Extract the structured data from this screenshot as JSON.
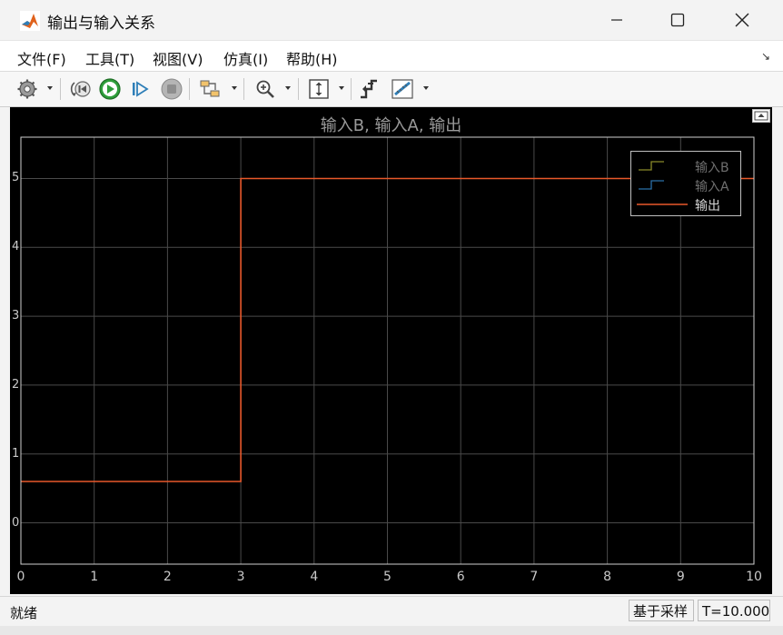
{
  "window": {
    "title": "输出与输入关系"
  },
  "menubar": {
    "items": [
      "文件(F)",
      "工具(T)",
      "视图(V)",
      "仿真(I)",
      "帮助(H)"
    ]
  },
  "toolbar": {
    "icons": [
      "settings-icon",
      "step-back-icon",
      "run-icon",
      "step-forward-icon",
      "stop-icon",
      "signal-selector-icon",
      "zoom-in-icon",
      "autoscale-icon",
      "triggers-icon",
      "measurements-icon"
    ]
  },
  "plot": {
    "title": "输入B, 输入A, 输出",
    "background": "#000000",
    "line_color": "#e8582a"
  },
  "chart_data": {
    "type": "line",
    "title": "输入B, 输入A, 输出",
    "xlabel": "",
    "ylabel": "",
    "xlim": [
      0,
      10
    ],
    "ylim": [
      -0.6,
      5.6
    ],
    "x_ticks": [
      "0",
      "1",
      "2",
      "3",
      "4",
      "5",
      "6",
      "7",
      "8",
      "9",
      "10"
    ],
    "y_ticks": [
      "0",
      "1",
      "2",
      "3",
      "4",
      "5"
    ],
    "grid": true,
    "legend_position": "top-right",
    "legend": [
      {
        "name": "输入B",
        "color": "#8a8a2a"
      },
      {
        "name": "输入A",
        "color": "#2a6fa8"
      },
      {
        "name": "输出",
        "color": "#e8582a"
      }
    ],
    "series": [
      {
        "name": "输出",
        "step": true,
        "x": [
          0,
          3,
          3,
          10
        ],
        "y": [
          0.6,
          0.6,
          5,
          5
        ]
      }
    ]
  },
  "statusbar": {
    "status": "就绪",
    "sample_mode": "基于采样",
    "time": "T=10.000"
  }
}
